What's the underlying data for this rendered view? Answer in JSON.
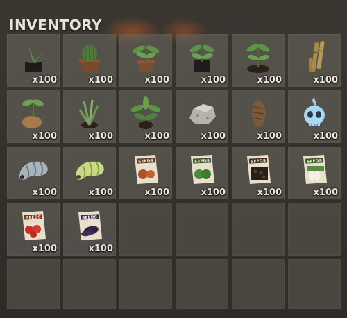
{
  "inventory": {
    "title": "INVENTORY",
    "slots": [
      {
        "icon": "aloe-plant-pot-icon",
        "qty": "x100"
      },
      {
        "icon": "cactus-pot-icon",
        "qty": "x100"
      },
      {
        "icon": "sapling-pot-icon",
        "qty": "x100"
      },
      {
        "icon": "sapling-pot-dark-icon",
        "qty": "x100"
      },
      {
        "icon": "sapling-soil-icon",
        "qty": "x100"
      },
      {
        "icon": "bamboo-sticks-icon",
        "qty": "x100"
      },
      {
        "icon": "potato-sprout-icon",
        "qty": "x100"
      },
      {
        "icon": "grass-sprout-icon",
        "qty": "x100"
      },
      {
        "icon": "leafy-plant-icon",
        "qty": "x100"
      },
      {
        "icon": "salt-rock-icon",
        "qty": "x100"
      },
      {
        "icon": "taro-root-icon",
        "qty": "x100"
      },
      {
        "icon": "ghost-skull-icon",
        "qty": "x100"
      },
      {
        "icon": "grey-grub-icon",
        "qty": "x100"
      },
      {
        "icon": "green-grub-icon",
        "qty": "x100"
      },
      {
        "icon": "onion-seeds-packet-icon",
        "qty": "x100"
      },
      {
        "icon": "cabbage-seeds-packet-icon",
        "qty": "x100"
      },
      {
        "icon": "bean-seeds-packet-icon",
        "qty": "x100"
      },
      {
        "icon": "radish-seeds-packet-icon",
        "qty": "x100"
      },
      {
        "icon": "tomato-seeds-packet-icon",
        "qty": "x100"
      },
      {
        "icon": "eggplant-seeds-packet-icon",
        "qty": "x100"
      }
    ],
    "packet_label": "SEEDS"
  }
}
